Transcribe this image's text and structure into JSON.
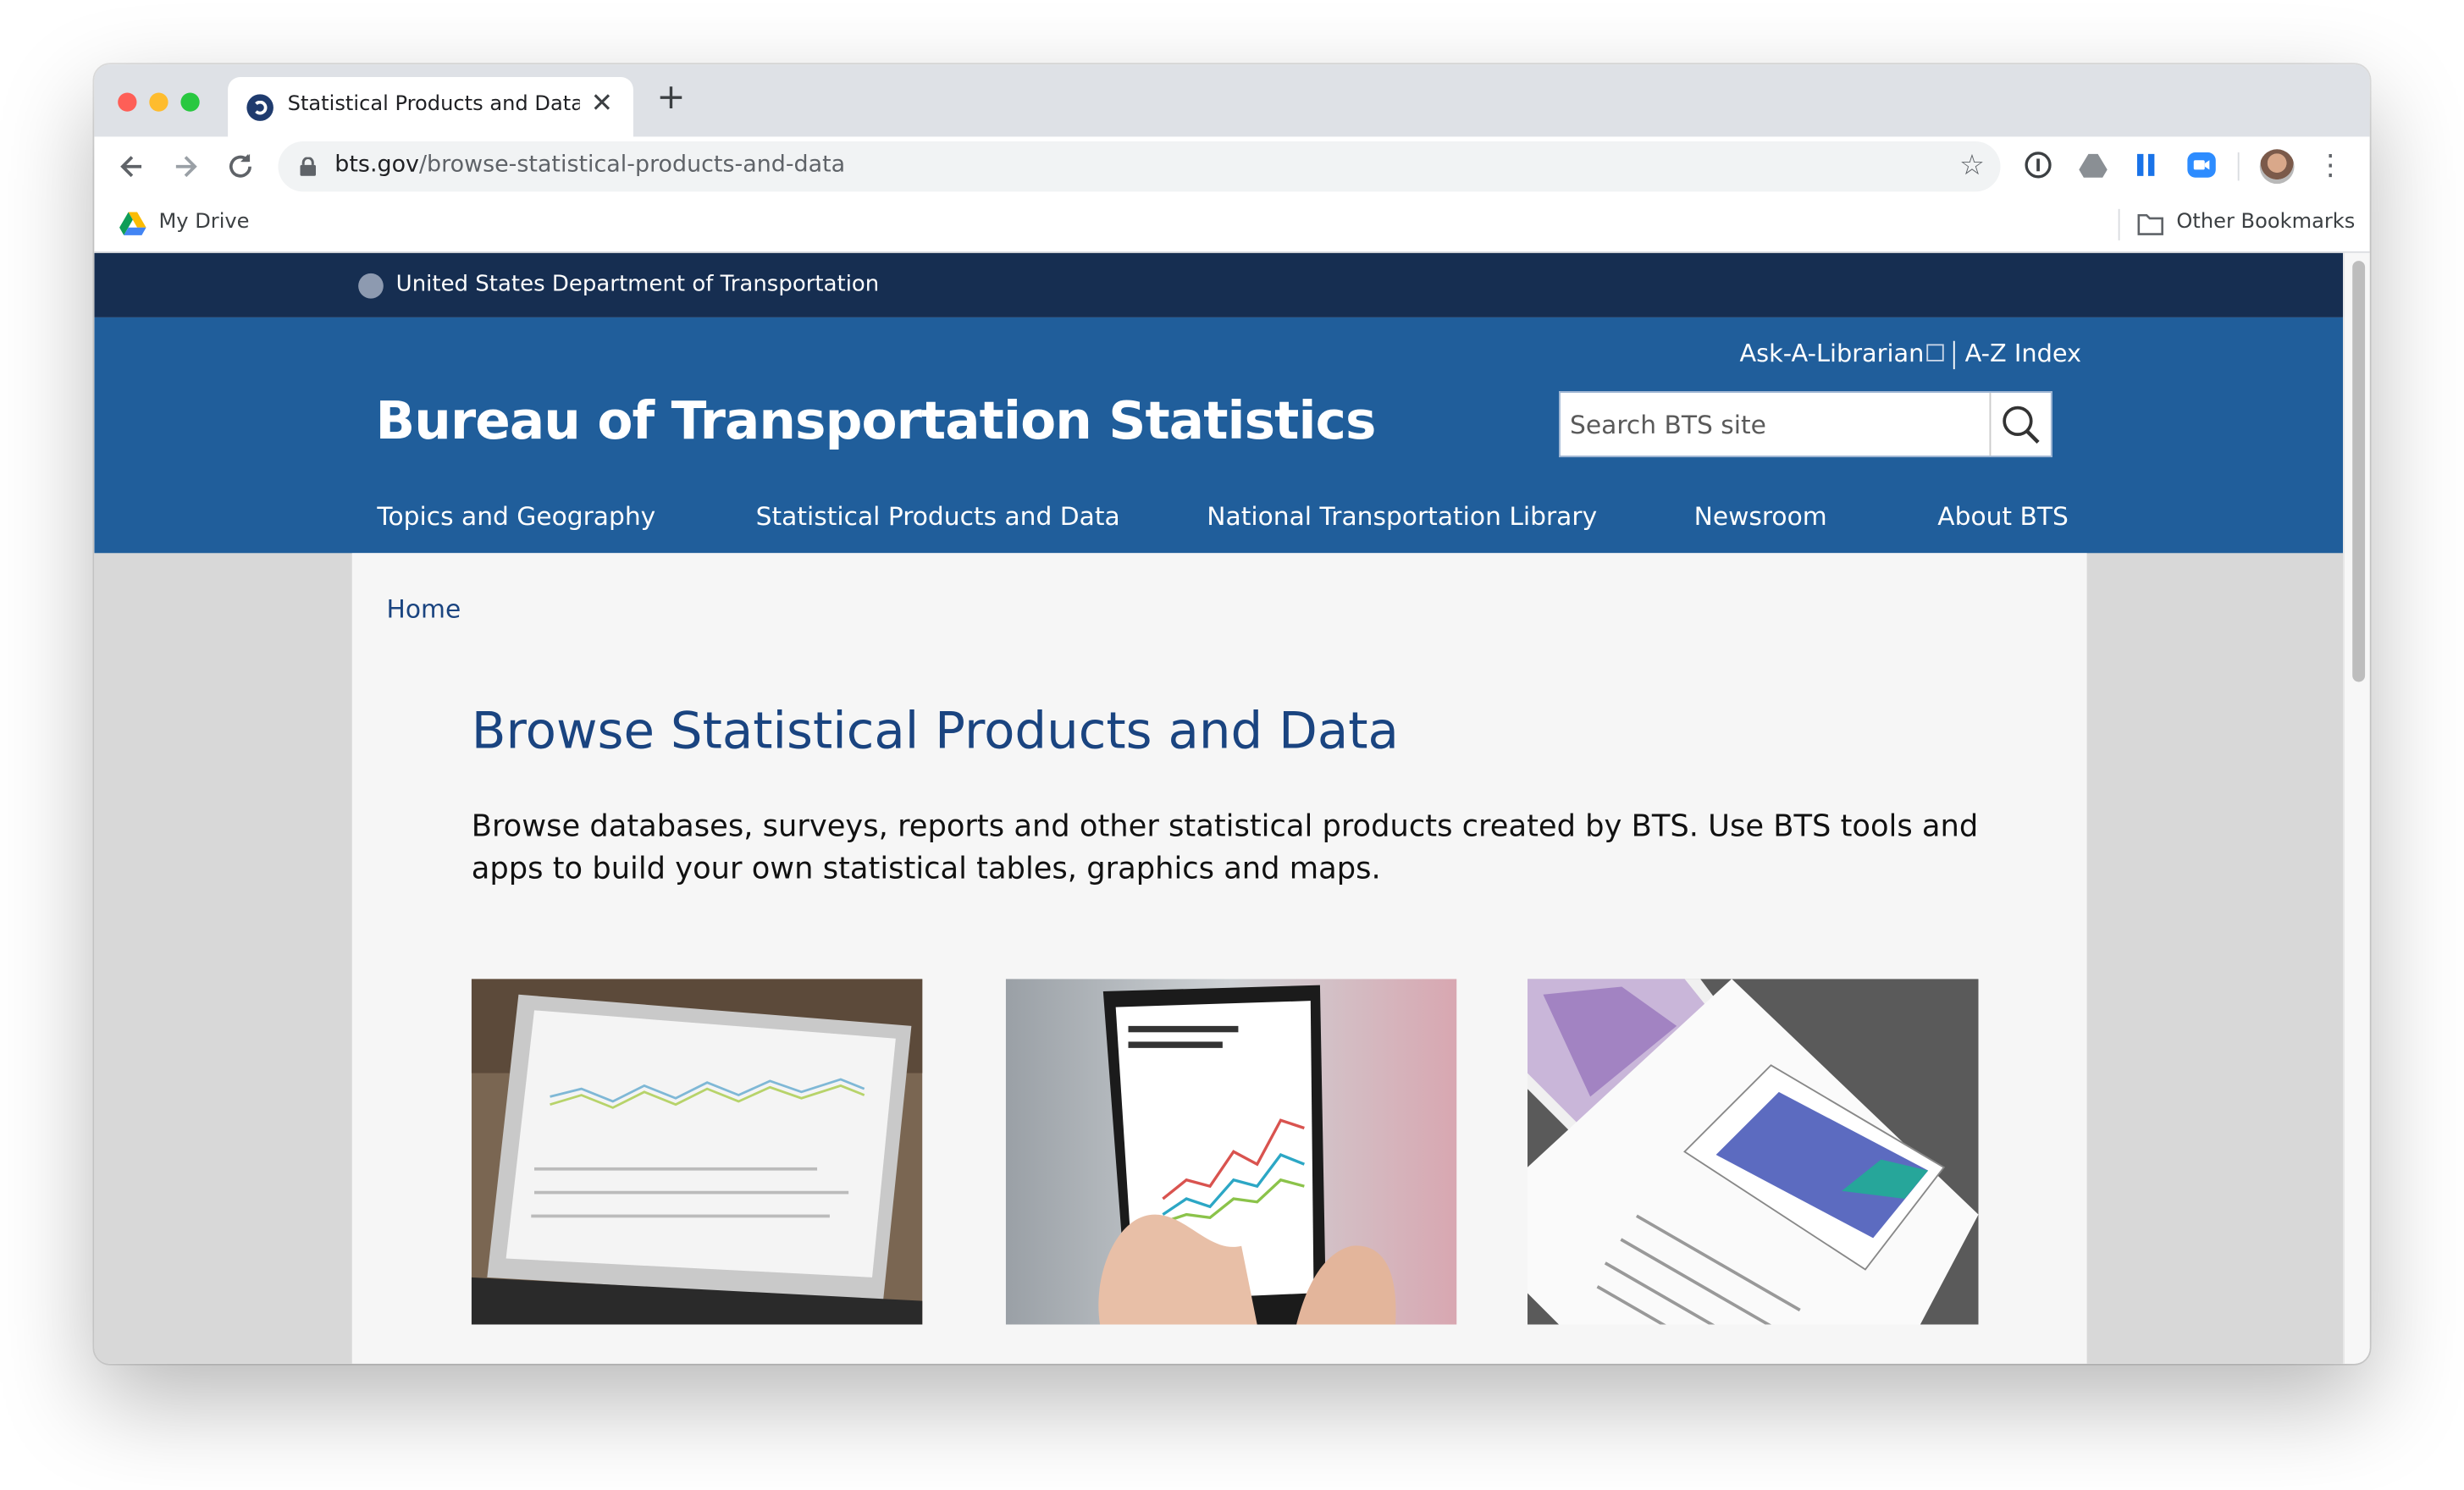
{
  "browser": {
    "tab_title": "Statistical Products and Data | Bureau of Transportation Statistics",
    "url_domain": "bts.gov",
    "url_path": "/browse-statistical-products-and-data",
    "bookmarks": [
      "My Drive"
    ],
    "other_bookmarks": "Other Bookmarks"
  },
  "gov_banner": {
    "text": "United States Department of Transportation"
  },
  "header": {
    "site_title": "Bureau of Transportation Statistics",
    "util_links": [
      "Ask-A-Librarian",
      "A-Z Index"
    ],
    "search_placeholder": "Search BTS site"
  },
  "nav": [
    "Topics and Geography",
    "Statistical Products and Data",
    "National Transportation Library",
    "Newsroom",
    "About BTS"
  ],
  "breadcrumb": "Home",
  "page": {
    "title": "Browse Statistical Products and Data",
    "intro": "Browse databases, surveys, reports and other statistical products created by BTS.  Use BTS tools and apps to build your own statistical tables, graphics and maps."
  },
  "colors": {
    "gov_banner": "#162e51",
    "header": "#205e9b",
    "title": "#1a4480"
  }
}
